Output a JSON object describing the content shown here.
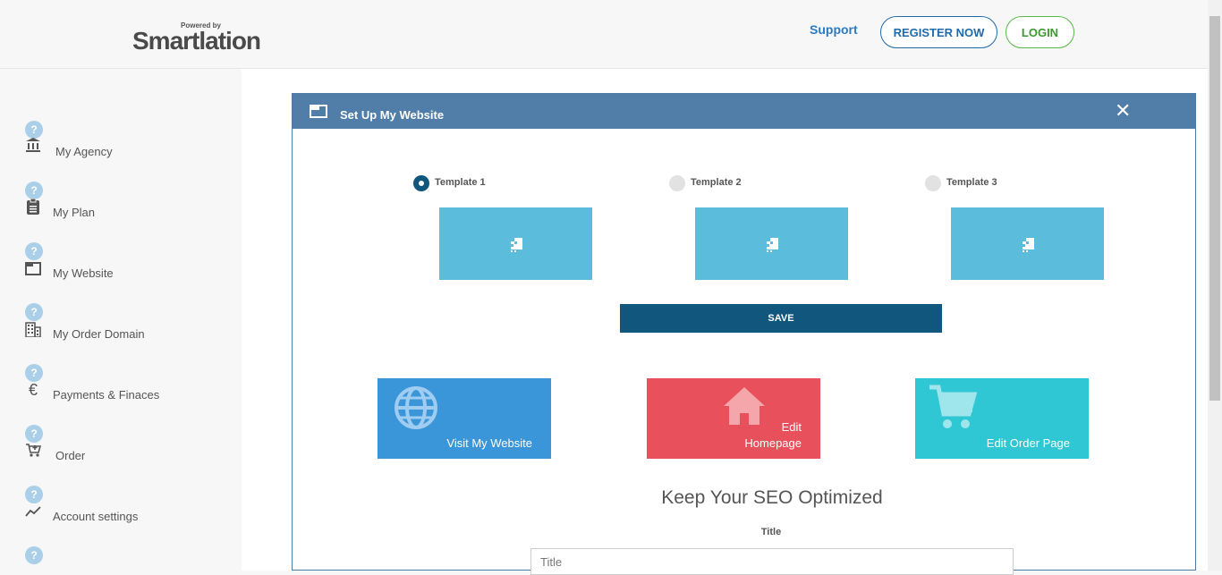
{
  "header": {
    "logo_powered": "Powered by",
    "logo_brand": "Smartlation",
    "support_label": "Support",
    "register_label": "REGISTER NOW",
    "login_label": "LOGIN"
  },
  "sidebar": {
    "help_glyph": "?",
    "items": [
      {
        "label": "My Agency",
        "icon": "bank-icon"
      },
      {
        "label": "My Plan",
        "icon": "clipboard-icon"
      },
      {
        "label": "My Website",
        "icon": "window-icon"
      },
      {
        "label": "My Order Domain",
        "icon": "building-icon"
      },
      {
        "label": "Payments & Finaces",
        "icon": "euro-icon"
      },
      {
        "label": "Order",
        "icon": "cart-add-icon"
      },
      {
        "label": "Account settings",
        "icon": "trend-icon"
      }
    ]
  },
  "panel": {
    "title": "Set Up My Website",
    "close_glyph": "✕",
    "templates": [
      {
        "label": "Template 1",
        "selected": true
      },
      {
        "label": "Template 2",
        "selected": false
      },
      {
        "label": "Template 3",
        "selected": false
      }
    ],
    "save_label": "SAVE",
    "actions": [
      {
        "label": "Visit My Website",
        "color": "#3a95d9",
        "icon": "globe-icon"
      },
      {
        "label_line1": "Edit",
        "label_line2": "Homepage",
        "color": "#e8505b",
        "icon": "home-icon"
      },
      {
        "label": "Edit Order Page",
        "color": "#2fc7d4",
        "icon": "cart-icon"
      }
    ],
    "seo_heading": "Keep Your SEO Optimized",
    "title_field_label": "Title",
    "title_placeholder": "Title"
  },
  "colors": {
    "header_bar": "#507ea8",
    "save_button": "#11577d",
    "template_thumb": "#5bbcdc"
  }
}
